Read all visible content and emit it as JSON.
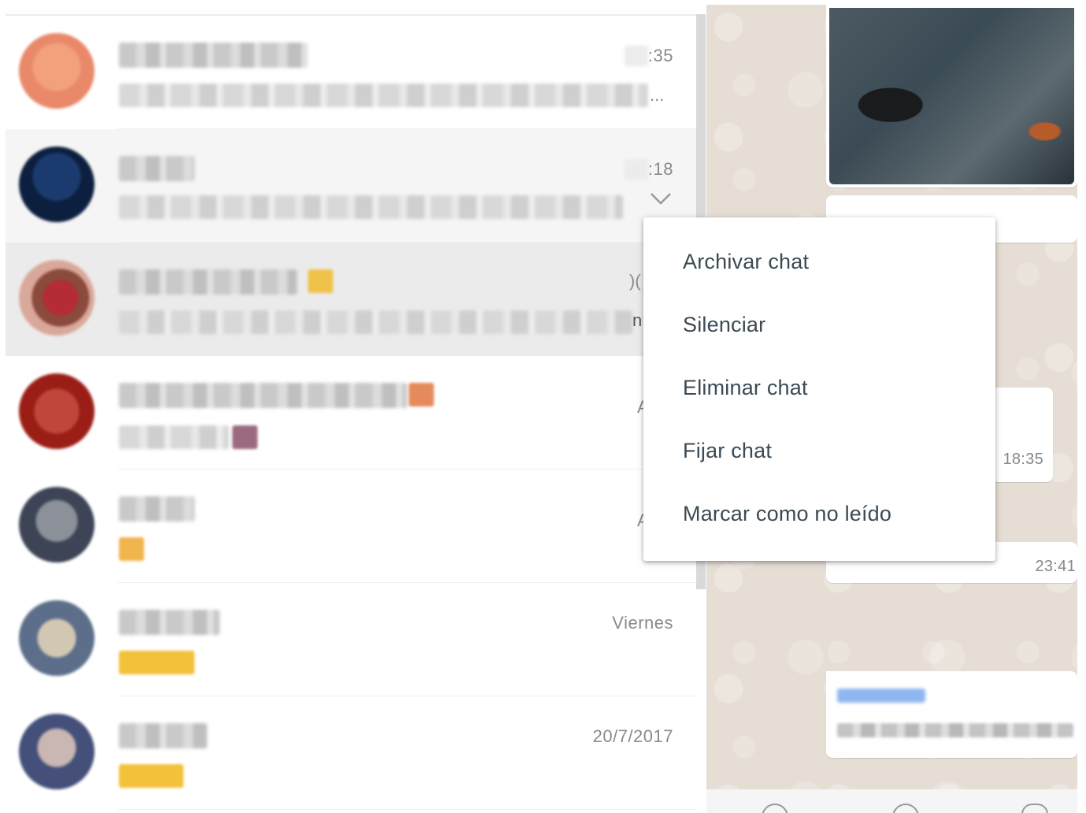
{
  "chat_list": {
    "rows": [
      {
        "time": ":35",
        "preview_tail": "..."
      },
      {
        "time": ":18"
      },
      {
        "time_peek": ")(",
        "preview_peek": "n"
      },
      {
        "time_peek": "A"
      },
      {
        "time_peek": "A"
      },
      {
        "time": "Viernes"
      },
      {
        "time": "20/7/2017"
      }
    ]
  },
  "context_menu": {
    "items": [
      "Archivar chat",
      "Silenciar",
      "Eliminar chat",
      "Fijar chat",
      "Marcar como no leído"
    ]
  },
  "conversation": {
    "times": [
      "18:35",
      "23:41"
    ]
  },
  "colors": {
    "menu_text": "#3b4a54",
    "time_text": "#8a8a8a",
    "chat_wallpaper": "#e6ddd4",
    "selected_row": "#ebebeb",
    "hover_row": "#f5f5f5"
  },
  "icons": [
    "chevron-down-icon",
    "emoji-icon",
    "attach-icon",
    "mic-icon"
  ]
}
